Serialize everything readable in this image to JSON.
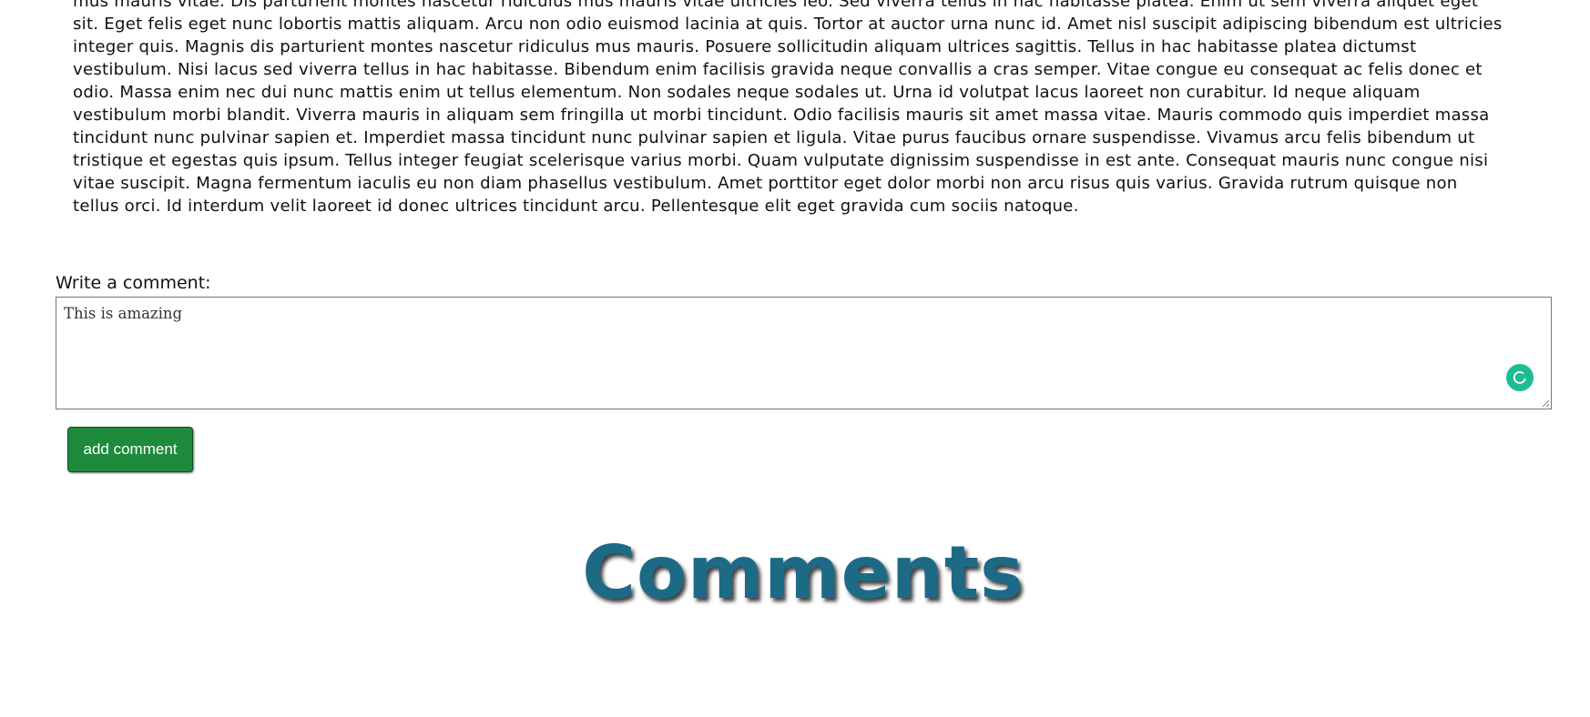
{
  "article": {
    "body": "mus mauris vitae. Dis parturient montes nascetur ridiculus mus mauris vitae ultricies leo. Sed viverra tellus in hac habitasse platea. Enim ut sem viverra aliquet eget\nsit. Eget felis eget nunc lobortis mattis aliquam. Arcu non odio euismod lacinia at quis. Tortor at auctor urna nunc id. Amet nisl suscipit adipiscing bibendum est ultricies\ninteger quis. Magnis dis parturient montes nascetur ridiculus mus mauris. Posuere sollicitudin aliquam ultrices sagittis. Tellus in hac habitasse platea dictumst\nvestibulum. Nisi lacus sed viverra tellus in hac habitasse. Bibendum enim facilisis gravida neque convallis a cras semper. Vitae congue eu consequat ac felis donec et\nodio. Massa enim nec dui nunc mattis enim ut tellus elementum. Non sodales neque sodales ut. Urna id volutpat lacus laoreet non curabitur. Id neque aliquam\nvestibulum morbi blandit. Viverra mauris in aliquam sem fringilla ut morbi tincidunt. Odio facilisis mauris sit amet massa vitae. Mauris commodo quis imperdiet massa\ntincidunt nunc pulvinar sapien et. Imperdiet massa tincidunt nunc pulvinar sapien et ligula. Vitae purus faucibus ornare suspendisse. Vivamus arcu felis bibendum ut\ntristique et egestas quis ipsum. Tellus integer feugiat scelerisque varius morbi. Quam vulputate dignissim suspendisse in est ante. Consequat mauris nunc congue nisi\nvitae suscipit. Magna fermentum iaculis eu non diam phasellus vestibulum. Amet porttitor eget dolor morbi non arcu risus quis varius. Gravida rutrum quisque non\ntellus orci. Id interdum velit laoreet id donec ultrices tincidunt arcu. Pellentesque elit eget gravida cum sociis natoque."
  },
  "comment_form": {
    "label": "Write a comment:",
    "value": "This is amazing",
    "grammar_icon": "grammarly-icon",
    "submit_label": "add comment",
    "submit_color": "#1e8a3c"
  },
  "comments_section": {
    "heading": "Comments",
    "heading_color": "#1d6a87"
  }
}
